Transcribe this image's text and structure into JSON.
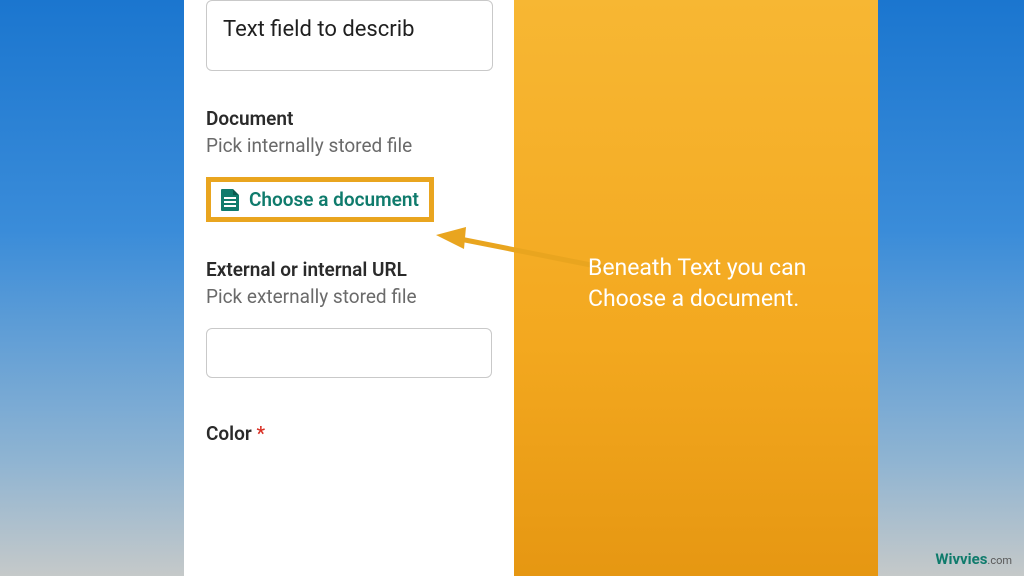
{
  "form": {
    "textfield_placeholder": "Text field to describ",
    "document_label": "Document",
    "document_hint": "Pick internally stored file",
    "choose_button": "Choose a document",
    "url_label": "External or internal URL",
    "url_hint": "Pick externally stored file",
    "color_label": "Color",
    "required_mark": "*"
  },
  "callout": {
    "line1": "Beneath Text you can",
    "line2": "Choose a document."
  },
  "watermark": {
    "brand": "Wivvies",
    "suffix": ".com"
  }
}
